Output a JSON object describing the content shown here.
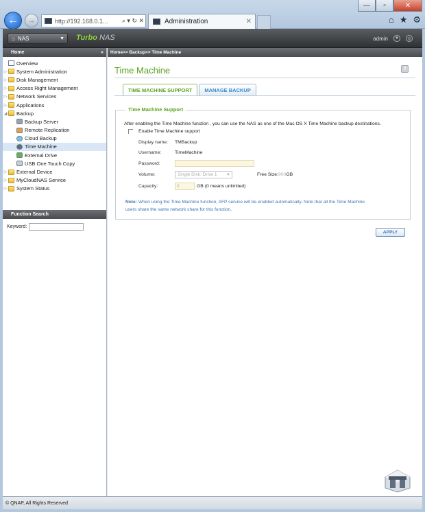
{
  "browser": {
    "url": "http://192.168.0.1...",
    "url_controls": "⌕ ▾ ↻ ✕",
    "tab_title": "Administration",
    "window_controls": [
      "—",
      "▫",
      "✕"
    ],
    "toolbar_icons": [
      "home-icon",
      "star-icon",
      "gear-icon"
    ]
  },
  "header": {
    "nas_selector": "NAS",
    "brand_part1": "Turbo",
    "brand_part2": "NAS",
    "user": "admin"
  },
  "sidebar": {
    "header": "Home",
    "items": [
      {
        "label": "Overview",
        "icon": "doc"
      },
      {
        "label": "System Administration",
        "icon": "folder"
      },
      {
        "label": "Disk Management",
        "icon": "folder"
      },
      {
        "label": "Access Right Management",
        "icon": "folder"
      },
      {
        "label": "Network Services",
        "icon": "folder"
      },
      {
        "label": "Applications",
        "icon": "folder"
      },
      {
        "label": "Backup",
        "icon": "folder"
      },
      {
        "label": "Backup Server",
        "icon": "child"
      },
      {
        "label": "Remote Replication",
        "icon": "child"
      },
      {
        "label": "Cloud Backup",
        "icon": "child"
      },
      {
        "label": "Time Machine",
        "icon": "child"
      },
      {
        "label": "External Drive",
        "icon": "child"
      },
      {
        "label": "USB One Touch Copy",
        "icon": "child"
      },
      {
        "label": "External Device",
        "icon": "folder"
      },
      {
        "label": "MyCloudNAS Service",
        "icon": "folder"
      },
      {
        "label": "System Status",
        "icon": "folder"
      }
    ],
    "function_search_header": "Function Search",
    "keyword_label": "Keyword:"
  },
  "main": {
    "breadcrumb": "Home>> Backup>> Time Machine",
    "title": "Time Machine",
    "help": "?",
    "tabs": [
      "TIME MACHINE SUPPORT",
      "MANAGE BACKUP"
    ],
    "section_title": "Time Machine Support",
    "intro": "After enabling the Time Machine function , you can use the NAS as one of the Mac OS X Time Machine backup destinations.",
    "enable_label": "Enable Time Machine support",
    "display_name_label": "Display name:",
    "display_name_value": "TMBackup",
    "username_label": "Username:",
    "username_value": "TimeMachine",
    "password_label": "Password:",
    "volume_label": "Volume:",
    "volume_value": "Single Disk: Drive  1",
    "free_size_label": "Free Size:",
    "free_size_value": "900",
    "free_size_unit": "GB",
    "capacity_label": "Capacity:",
    "capacity_value": "0",
    "capacity_suffix": "GB (0 means unlimited)",
    "note_label": "Note:",
    "note_line1": " When using the Time Machine function, AFP service will be enabled automatically. Note that all the Time Machine",
    "note_line2": "users share the same network share for this function.",
    "apply_label": "APPLY"
  },
  "footer": "© QNAP, All Rights Reserved",
  "colors": {
    "accent_green": "#5aa21f",
    "link_blue": "#3b73b8"
  }
}
